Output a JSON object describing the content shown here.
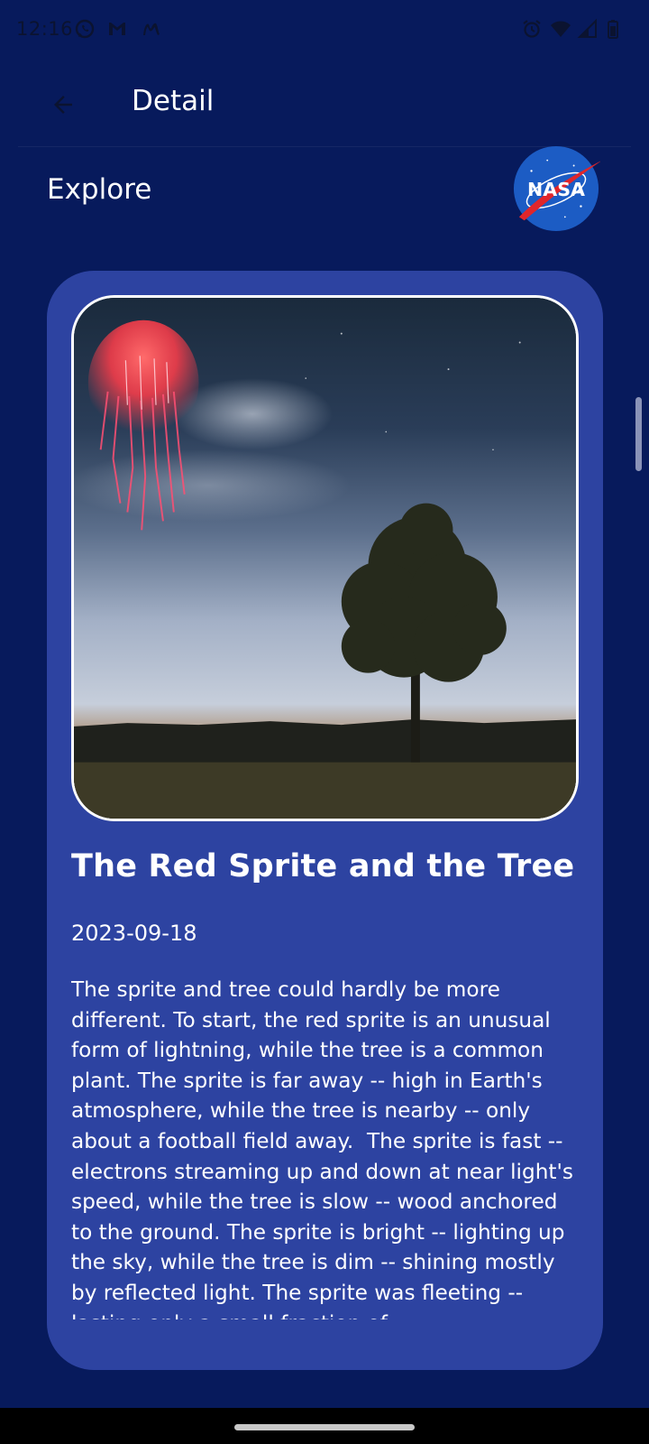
{
  "status_bar": {
    "time": "12:16",
    "left_icons": [
      "whatsapp-icon",
      "gmail-icon",
      "movistar-icon"
    ],
    "right_icons": [
      "alarm-icon",
      "wifi-icon",
      "signal-icon",
      "battery-icon"
    ],
    "icon_color": "#0b1330"
  },
  "app_bar": {
    "title": "Detail",
    "back_icon": "arrow-back-icon"
  },
  "header": {
    "explore_label": "Explore",
    "logo_icon": "nasa-logo",
    "logo_text": "NASA"
  },
  "item": {
    "image_description_icon": "red-sprite-tree-photo",
    "title": "The Red Sprite and the Tree",
    "date": "2023-09-18",
    "explanation": "The sprite and tree could hardly be more different. To start, the red sprite is an unusual form of lightning, while the tree is a common plant. The sprite is far away -- high in Earth's atmosphere, while the tree is nearby -- only about a football field away.  The sprite is fast -- electrons streaming up and down at near light's speed, while the tree is slow -- wood anchored to the ground. The sprite is bright -- lighting up the sky, while the tree is dim -- shining mostly by reflected light. The sprite was fleeting -- lasting only a small fraction of"
  },
  "colors": {
    "background": "#071a5c",
    "card": "#2d43a1",
    "text": "#ffffff"
  }
}
